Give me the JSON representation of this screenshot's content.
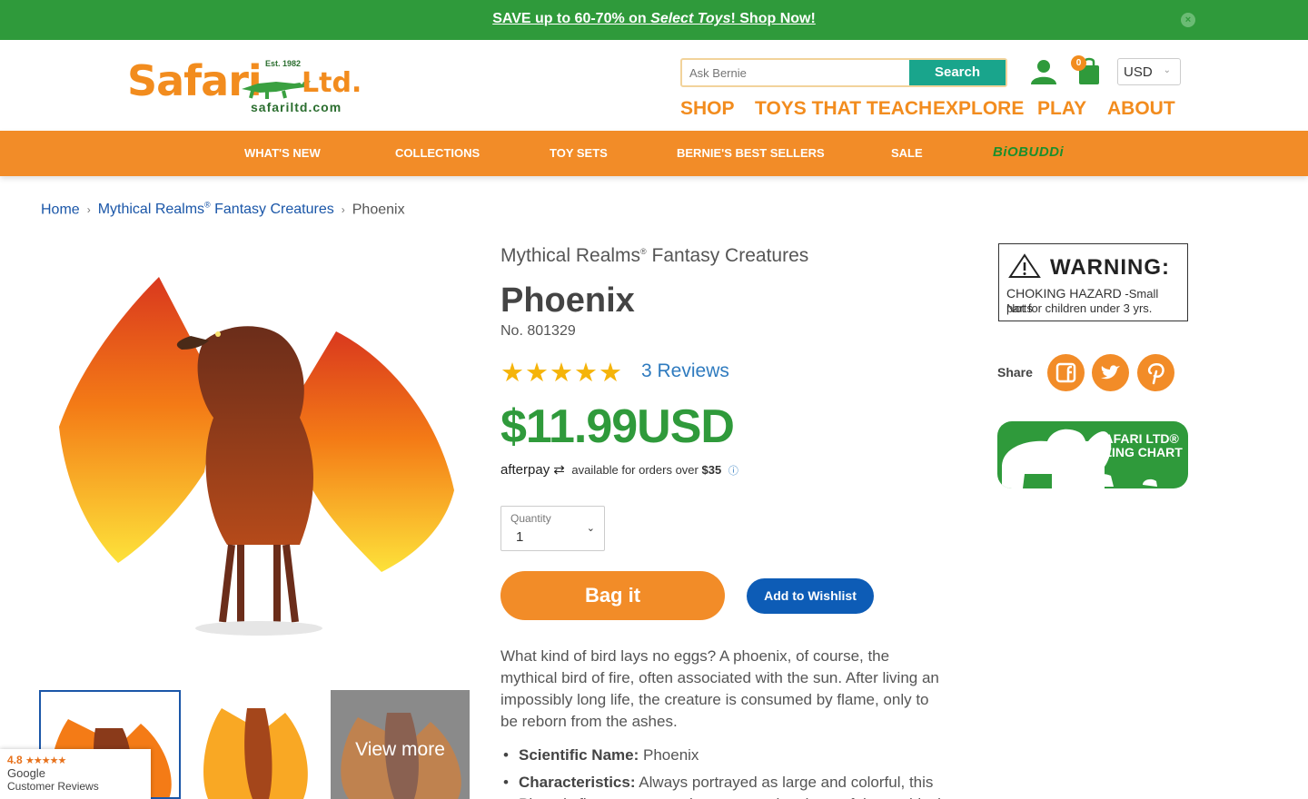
{
  "promo": {
    "part1": "SAVE up to 60-70% on ",
    "part2": "Select Toys",
    "part3": "! Shop Now!"
  },
  "logo": {
    "brand": "Safari",
    "suffix": "Ltd.",
    "est": "Est. 1982",
    "url": "safariltd.com"
  },
  "search": {
    "placeholder": "Ask Bernie",
    "button": "Search"
  },
  "cart": {
    "count": "0"
  },
  "currency": {
    "selected": "USD"
  },
  "main_nav": [
    "SHOP",
    "TOYS THAT TEACH",
    "EXPLORE",
    "PLAY",
    "ABOUT"
  ],
  "categories": [
    "WHAT'S NEW",
    "COLLECTIONS",
    "TOY SETS",
    "BERNIE'S BEST SELLERS",
    "SALE",
    "BiOBUDDi"
  ],
  "breadcrumb": {
    "home": "Home",
    "collection": "Mythical Realms",
    "collection_sup": "®",
    "collection_rest": " Fantasy Creatures",
    "current": "Phoenix"
  },
  "product": {
    "collection": "Mythical Realms",
    "collection_sup": "®",
    "collection_rest": " Fantasy Creatures",
    "title": "Phoenix",
    "sku": "No. 801329",
    "stars": "★★★★★",
    "rating": 5,
    "reviews": "3 Reviews",
    "price": "$11.99USD",
    "afterpay_logo": "afterpay",
    "afterpay_text": "available for orders over",
    "afterpay_amount": "$35",
    "quantity_label": "Quantity",
    "quantity_value": "1",
    "bag_button": "Bag it",
    "wishlist_button": "Add to Wishlist",
    "description": "What kind of bird lays no eggs? A phoenix, of course, the mythical bird of fire, often associated with the sun. After living an impossibly long life, the creature is consumed by flame, only to be reborn from the ashes.",
    "bullets": [
      {
        "label": "Scientific Name:",
        "text": " Phoenix"
      },
      {
        "label": "Characteristics:",
        "text": " Always portrayed as large and colorful, this Phoenix figure captures the grace and majesty of the mythical"
      }
    ]
  },
  "gallery": {
    "view_more": "View more"
  },
  "google_badge": {
    "rating": "4.8",
    "stars": "★★★★★",
    "name": "Google",
    "label": "Customer Reviews"
  },
  "warning": {
    "head": "WARNING:",
    "hazard": "CHOKING HAZARD",
    "hazard_rest": " -Small parts",
    "line2": "Not for children under 3 yrs."
  },
  "share": {
    "label": "Share"
  },
  "sizing": {
    "text": "SAFARI LTD® SIZING CHART"
  },
  "colors": {
    "green": "#2f9a3b",
    "orange": "#f28c28",
    "blue": "#0d5cb6",
    "link": "#1a56a8"
  }
}
